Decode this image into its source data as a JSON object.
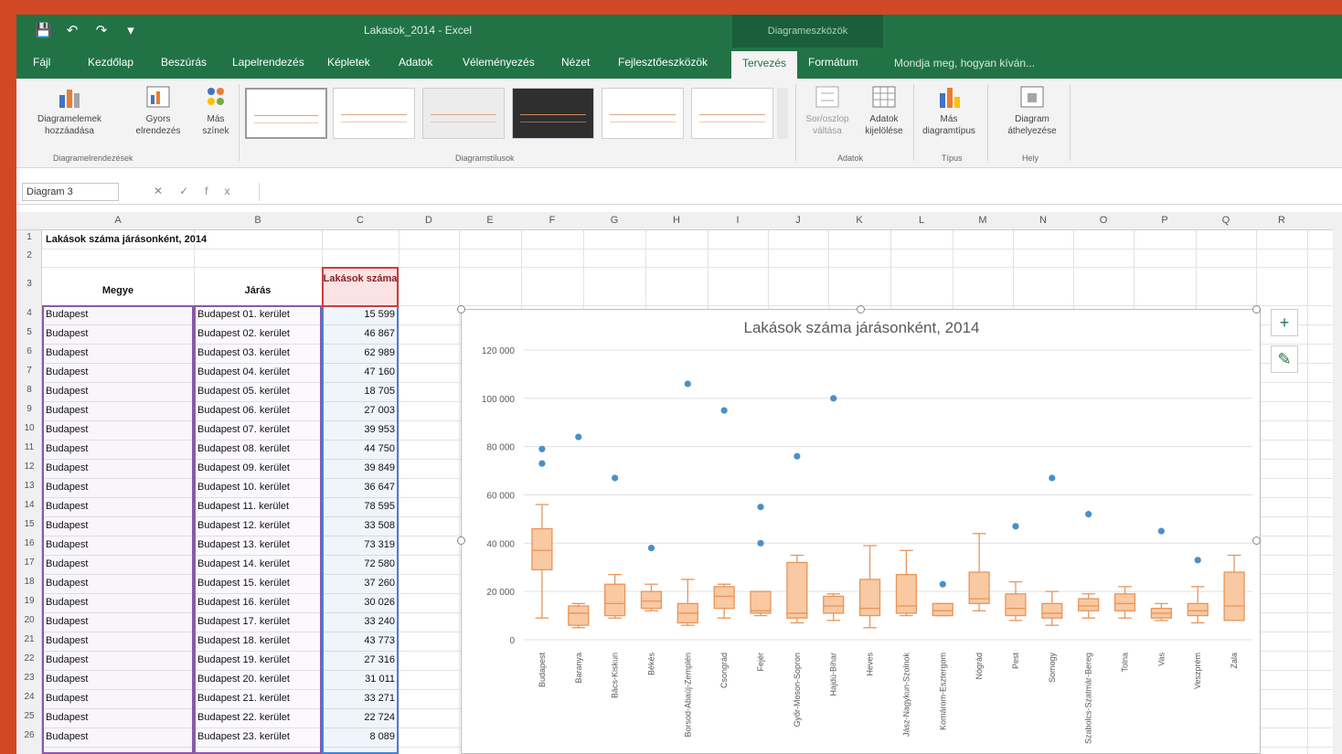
{
  "window": {
    "title": "Lakasok_2014 - Excel",
    "context_tab_group": "Diagrameszközök",
    "quick_access": [
      "save-icon",
      "undo-icon",
      "redo-icon",
      "customize-icon"
    ]
  },
  "ribbon_tabs": [
    {
      "label": "Fájl",
      "active": false
    },
    {
      "label": "Kezdőlap",
      "active": false
    },
    {
      "label": "Beszúrás",
      "active": false
    },
    {
      "label": "Lapelrendezés",
      "active": false
    },
    {
      "label": "Képletek",
      "active": false
    },
    {
      "label": "Adatok",
      "active": false
    },
    {
      "label": "Véleményezés",
      "active": false
    },
    {
      "label": "Nézet",
      "active": false
    },
    {
      "label": "Fejlesztőeszközök",
      "active": false
    },
    {
      "label": "Tervezés",
      "active": true
    },
    {
      "label": "Formátum",
      "active": false
    }
  ],
  "tell_me": "Mondja meg, hogyan kíván...",
  "ribbon": {
    "add_element": "Diagramelemek hozzáadása",
    "quick_layout": "Gyors elrendezés",
    "change_colors": "Más színek",
    "group_layouts": "Diagramelrendezések",
    "group_styles": "Diagramstílusok",
    "switch_row_col": "Sor/oszlop váltása",
    "select_data": "Adatok kijelölése",
    "group_data": "Adatok",
    "change_type": "Más diagramtípus",
    "group_type": "Típus",
    "move_chart": "Diagram áthelyezése",
    "group_location": "Hely"
  },
  "formula_bar": {
    "name_box": "Diagram 3",
    "value": ""
  },
  "columns": [
    "A",
    "B",
    "C",
    "D",
    "E",
    "F",
    "G",
    "H",
    "I",
    "J",
    "K",
    "L",
    "M",
    "N",
    "O",
    "P",
    "Q",
    "R"
  ],
  "sheet": {
    "title": "Lakások száma járásonként, 2014",
    "headers": {
      "a": "Megye",
      "b": "Járás",
      "c": "Lakások száma"
    },
    "rows": [
      {
        "r": "4",
        "a": "Budapest",
        "b": "Budapest 01. kerület",
        "c": "15 599"
      },
      {
        "r": "5",
        "a": "Budapest",
        "b": "Budapest 02. kerület",
        "c": "46 867"
      },
      {
        "r": "6",
        "a": "Budapest",
        "b": "Budapest 03. kerület",
        "c": "62 989"
      },
      {
        "r": "7",
        "a": "Budapest",
        "b": "Budapest 04. kerület",
        "c": "47 160"
      },
      {
        "r": "8",
        "a": "Budapest",
        "b": "Budapest 05. kerület",
        "c": "18 705"
      },
      {
        "r": "9",
        "a": "Budapest",
        "b": "Budapest 06. kerület",
        "c": "27 003"
      },
      {
        "r": "10",
        "a": "Budapest",
        "b": "Budapest 07. kerület",
        "c": "39 953"
      },
      {
        "r": "11",
        "a": "Budapest",
        "b": "Budapest 08. kerület",
        "c": "44 750"
      },
      {
        "r": "12",
        "a": "Budapest",
        "b": "Budapest 09. kerület",
        "c": "39 849"
      },
      {
        "r": "13",
        "a": "Budapest",
        "b": "Budapest 10. kerület",
        "c": "36 647"
      },
      {
        "r": "14",
        "a": "Budapest",
        "b": "Budapest 11. kerület",
        "c": "78 595"
      },
      {
        "r": "15",
        "a": "Budapest",
        "b": "Budapest 12. kerület",
        "c": "33 508"
      },
      {
        "r": "16",
        "a": "Budapest",
        "b": "Budapest 13. kerület",
        "c": "73 319"
      },
      {
        "r": "17",
        "a": "Budapest",
        "b": "Budapest 14. kerület",
        "c": "72 580"
      },
      {
        "r": "18",
        "a": "Budapest",
        "b": "Budapest 15. kerület",
        "c": "37 260"
      },
      {
        "r": "19",
        "a": "Budapest",
        "b": "Budapest 16. kerület",
        "c": "30 026"
      },
      {
        "r": "20",
        "a": "Budapest",
        "b": "Budapest 17. kerület",
        "c": "33 240"
      },
      {
        "r": "21",
        "a": "Budapest",
        "b": "Budapest 18. kerület",
        "c": "43 773"
      },
      {
        "r": "22",
        "a": "Budapest",
        "b": "Budapest 19. kerület",
        "c": "27 316"
      },
      {
        "r": "23",
        "a": "Budapest",
        "b": "Budapest 20. kerület",
        "c": "31 011"
      },
      {
        "r": "24",
        "a": "Budapest",
        "b": "Budapest 21. kerület",
        "c": "33 271"
      },
      {
        "r": "25",
        "a": "Budapest",
        "b": "Budapest 22. kerület",
        "c": "22 724"
      },
      {
        "r": "26",
        "a": "Budapest",
        "b": "Budapest 23. kerület",
        "c": "8 089"
      }
    ]
  },
  "chart_data": {
    "type": "box",
    "title": "Lakások száma járásonként, 2014",
    "ylim": [
      0,
      120000
    ],
    "yticks": [
      "0",
      "20 000",
      "40 000",
      "60 000",
      "80 000",
      "100 000",
      "120 000"
    ],
    "grid": true,
    "box_fill": "#f8c9a2",
    "box_stroke": "#e8955a",
    "outlier_color": "#4a90c9",
    "categories": [
      {
        "name": "Budapest",
        "min": 9000,
        "q1": 29000,
        "median": 37000,
        "q3": 46000,
        "max": 56000,
        "outliers": [
          73000,
          79000
        ]
      },
      {
        "name": "Baranya",
        "min": 5000,
        "q1": 6000,
        "median": 11000,
        "q3": 14000,
        "max": 15000,
        "outliers": [
          84000
        ]
      },
      {
        "name": "Bács-Kiskun",
        "min": 9000,
        "q1": 10000,
        "median": 15000,
        "q3": 23000,
        "max": 27000,
        "outliers": [
          67000
        ]
      },
      {
        "name": "Békés",
        "min": 12000,
        "q1": 13000,
        "median": 16000,
        "q3": 20000,
        "max": 23000,
        "outliers": [
          38000
        ]
      },
      {
        "name": "Borsod-Abaúj-Zemplén",
        "min": 6000,
        "q1": 7000,
        "median": 11000,
        "q3": 15000,
        "max": 25000,
        "outliers": [
          106000
        ]
      },
      {
        "name": "Csongrád",
        "min": 9000,
        "q1": 13000,
        "median": 18000,
        "q3": 22000,
        "max": 23000,
        "outliers": [
          95000
        ]
      },
      {
        "name": "Fejér",
        "min": 10000,
        "q1": 11000,
        "median": 12000,
        "q3": 20000,
        "max": 20000,
        "outliers": [
          40000,
          55000
        ]
      },
      {
        "name": "Győr-Moson-Sopron",
        "min": 7000,
        "q1": 9000,
        "median": 11000,
        "q3": 32000,
        "max": 35000,
        "outliers": [
          76000
        ]
      },
      {
        "name": "Hajdú-Bihar",
        "min": 8000,
        "q1": 11000,
        "median": 14000,
        "q3": 18000,
        "max": 19000,
        "outliers": [
          100000
        ]
      },
      {
        "name": "Heves",
        "min": 5000,
        "q1": 10000,
        "median": 13000,
        "q3": 25000,
        "max": 39000,
        "outliers": []
      },
      {
        "name": "Jász-Nagykun-Szolnok",
        "min": 10000,
        "q1": 11000,
        "median": 14000,
        "q3": 27000,
        "max": 37000,
        "outliers": []
      },
      {
        "name": "Komárom-Esztergom",
        "min": 10000,
        "q1": 10000,
        "median": 12000,
        "q3": 15000,
        "max": 15000,
        "outliers": [
          23000
        ]
      },
      {
        "name": "Nógrád",
        "min": 12000,
        "q1": 15000,
        "median": 17000,
        "q3": 28000,
        "max": 44000,
        "outliers": []
      },
      {
        "name": "Pest",
        "min": 8000,
        "q1": 10000,
        "median": 13000,
        "q3": 19000,
        "max": 24000,
        "outliers": [
          47000
        ]
      },
      {
        "name": "Somogy",
        "min": 6000,
        "q1": 9000,
        "median": 11000,
        "q3": 15000,
        "max": 20000,
        "outliers": [
          67000
        ]
      },
      {
        "name": "Szabolcs-Szatmár-Bereg",
        "min": 9000,
        "q1": 12000,
        "median": 14000,
        "q3": 17000,
        "max": 19000,
        "outliers": [
          52000
        ]
      },
      {
        "name": "Tolna",
        "min": 9000,
        "q1": 12000,
        "median": 15000,
        "q3": 19000,
        "max": 22000,
        "outliers": []
      },
      {
        "name": "Vas",
        "min": 8000,
        "q1": 9000,
        "median": 11000,
        "q3": 13000,
        "max": 15000,
        "outliers": [
          45000
        ]
      },
      {
        "name": "Veszprém",
        "min": 7000,
        "q1": 10000,
        "median": 12000,
        "q3": 15000,
        "max": 22000,
        "outliers": [
          33000
        ]
      },
      {
        "name": "Zala",
        "min": 8000,
        "q1": 8000,
        "median": 14000,
        "q3": 28000,
        "max": 35000,
        "outliers": []
      }
    ]
  }
}
